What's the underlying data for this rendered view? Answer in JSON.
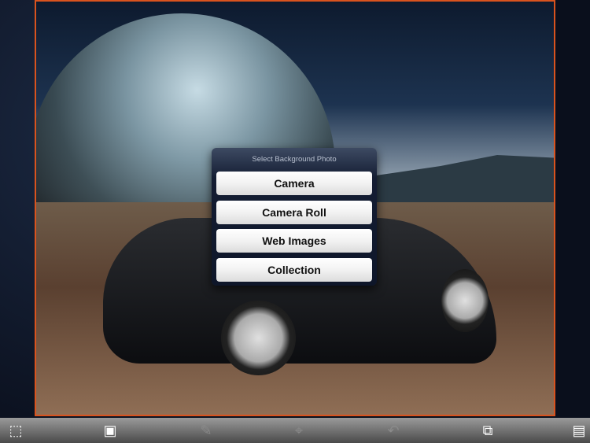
{
  "popup": {
    "title": "Select Background Photo",
    "options": [
      "Camera",
      "Camera Roll",
      "Web Images",
      "Collection"
    ]
  },
  "toolbar": {
    "icons": [
      "crop-select-icon",
      "add-photo-icon",
      "tools-icon",
      "zoom-icon",
      "undo-icon",
      "swap-layers-icon",
      "save-icon"
    ]
  },
  "colors": {
    "accent": "#d9531e"
  }
}
